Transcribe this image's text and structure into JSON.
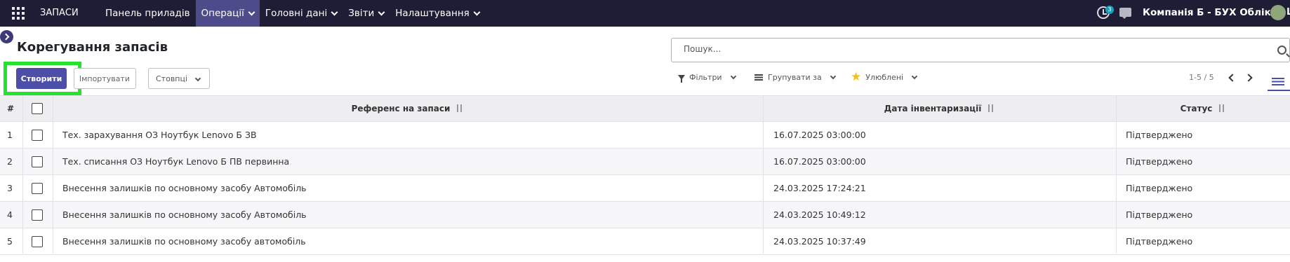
{
  "app": {
    "name": "ЗАПАСИ"
  },
  "nav": {
    "menu": [
      {
        "label": "Панель приладів",
        "has_dropdown": false,
        "active": false
      },
      {
        "label": "Операції",
        "has_dropdown": true,
        "active": true
      },
      {
        "label": "Головні дані",
        "has_dropdown": true,
        "active": false
      },
      {
        "label": "Звіти",
        "has_dropdown": true,
        "active": false
      },
      {
        "label": "Налаштування",
        "has_dropdown": true,
        "active": false
      }
    ],
    "activity_count": "3",
    "company": "Компанія Б - БУХ Облік",
    "user_initial": "Ц"
  },
  "page": {
    "title": "Корегування запасів",
    "create_label": "Створити",
    "import_label": "Імпортувати",
    "columns_label": "Стовпці"
  },
  "search": {
    "placeholder": "Пошук..."
  },
  "filters": {
    "filters_label": "Фільтри",
    "group_by_label": "Групувати за",
    "favorites_label": "Улюблені"
  },
  "pager": {
    "value": "1-5 / 5"
  },
  "table": {
    "headers": {
      "index": "#",
      "reference": "Референс на запаси",
      "date": "Дата інвентаризації",
      "status": "Статус"
    },
    "rows": [
      {
        "index": "1",
        "reference": "Тех. зарахування ОЗ Ноутбук Lenovo Б ЗВ",
        "date": "16.07.2025 03:00:00",
        "status": "Підтверджено"
      },
      {
        "index": "2",
        "reference": "Тех. списання ОЗ Ноутбук Lenovo Б ПВ первинна",
        "date": "16.07.2025 03:00:00",
        "status": "Підтверджено"
      },
      {
        "index": "3",
        "reference": "Внесення залишків по основному засобу Автомобіль",
        "date": "24.03.2025 17:24:21",
        "status": "Підтверджено"
      },
      {
        "index": "4",
        "reference": "Внесення залишків по основному засобу Автомобіль",
        "date": "24.03.2025 10:49:12",
        "status": "Підтверджено"
      },
      {
        "index": "5",
        "reference": "Внесення залишків по основному засобу автомобіль",
        "date": "24.03.2025 10:37:49",
        "status": "Підтверджено"
      }
    ]
  },
  "colors": {
    "navbar": "#1f1d36",
    "active_menu": "#4e4b8b",
    "primary": "#4d4ea8",
    "highlight": "#22e52b"
  }
}
